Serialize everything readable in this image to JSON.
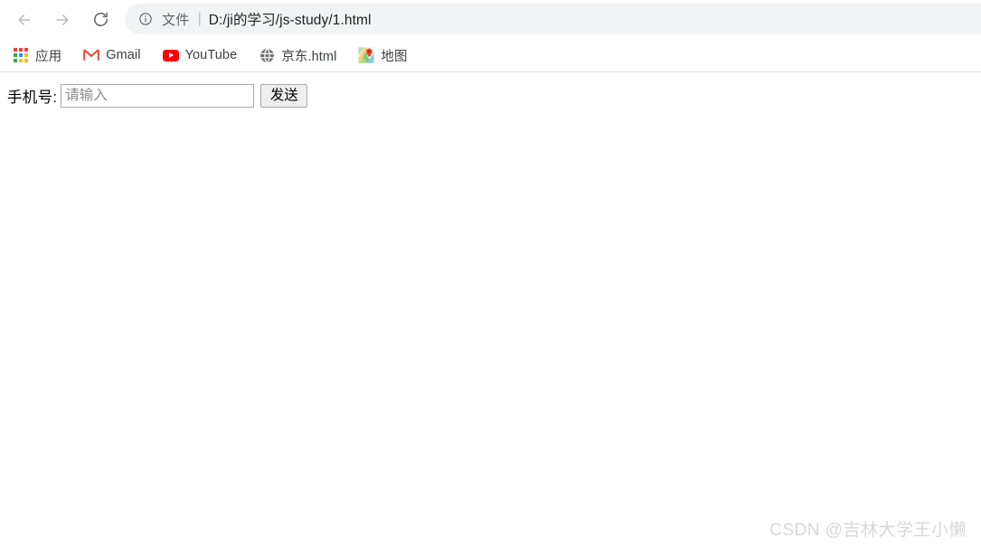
{
  "browser": {
    "nav": {
      "back_label": "Back",
      "back_icon": "arrow-left-icon",
      "forward_label": "Forward",
      "forward_icon": "arrow-right-icon",
      "reload_label": "Reload",
      "reload_icon": "reload-icon"
    },
    "omnibox": {
      "info_icon": "info-circle-icon",
      "scheme_label": "文件",
      "separator": "|",
      "url": "D:/ji的学习/js-study/1.html"
    },
    "bookmarks": [
      {
        "label": "应用",
        "icon": "apps-grid-icon"
      },
      {
        "label": "Gmail",
        "icon": "gmail-icon"
      },
      {
        "label": "YouTube",
        "icon": "youtube-icon"
      },
      {
        "label": "京东.html",
        "icon": "globe-icon"
      },
      {
        "label": "地图",
        "icon": "google-maps-icon"
      }
    ]
  },
  "page": {
    "form": {
      "label": "手机号:",
      "input_value": "",
      "input_placeholder": "请输入",
      "button_label": "发送"
    }
  },
  "watermark": {
    "text": "CSDN @吉林大学王小懒"
  },
  "colors": {
    "omnibox_bg": "#f1f3f4",
    "url_text": "#202124",
    "scheme_text": "#5f6368",
    "bookmark_text": "#3c4043",
    "separator_line": "#dadce0",
    "gmail_red": "#ea4335",
    "youtube_red": "#ff0000",
    "apps_red": "#ea4335",
    "apps_green": "#34a853",
    "apps_blue": "#4285f4",
    "apps_yellow": "#fbbc05",
    "input_border": "#a9a9a9",
    "button_bg": "#efefef",
    "watermark_gray": "#d8d8d8"
  }
}
